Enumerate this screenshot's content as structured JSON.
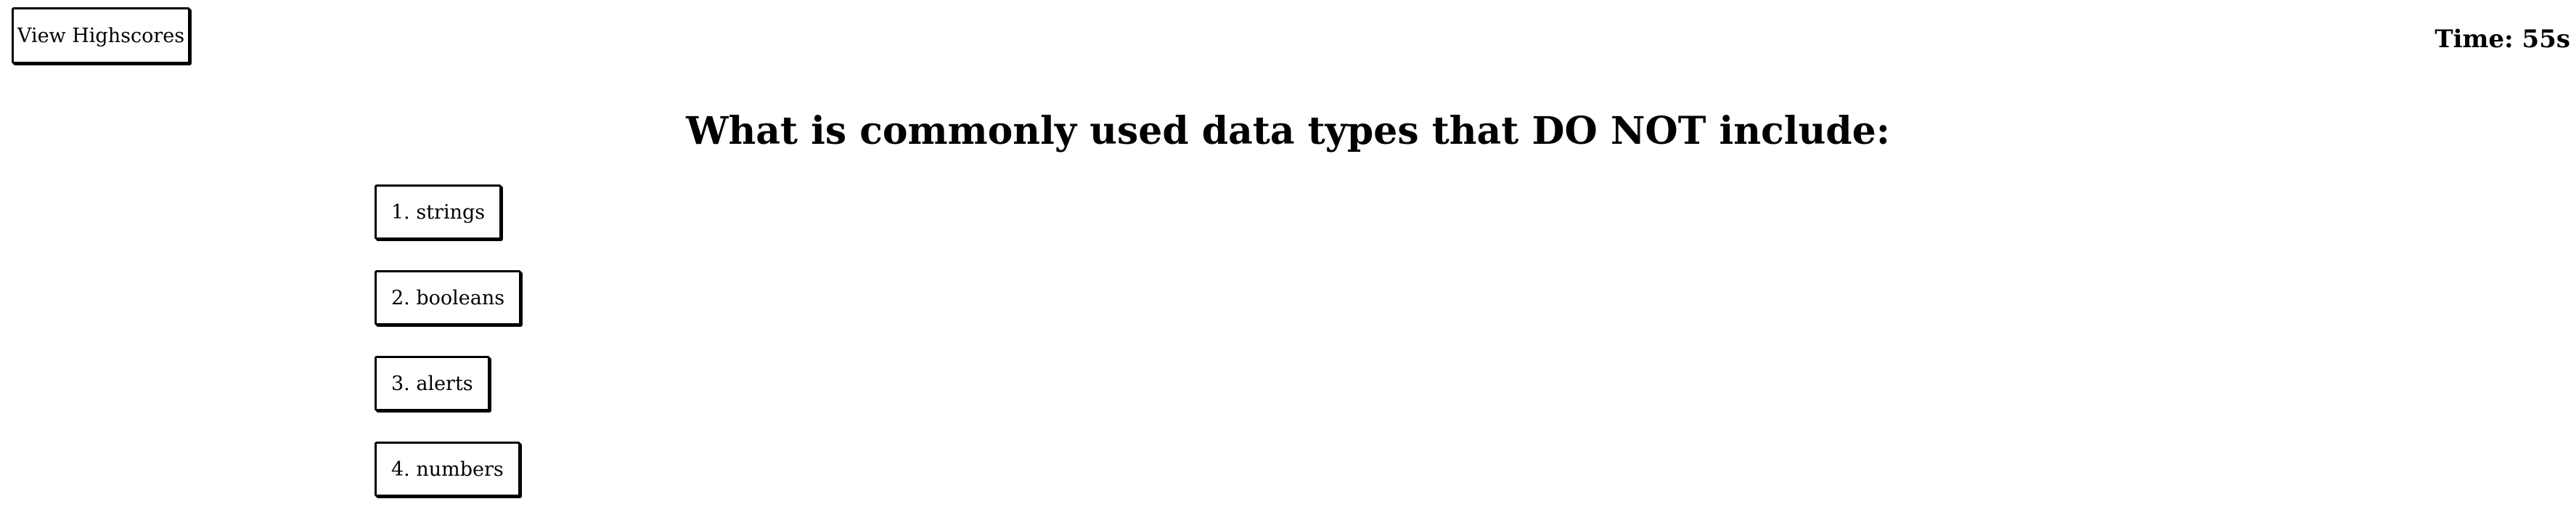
{
  "header": {
    "highscores_label": "View Highscores",
    "timer_text": "Time: 55s"
  },
  "quiz": {
    "question": "What is commonly used data types that DO NOT include:",
    "answers": [
      {
        "label": "1. strings"
      },
      {
        "label": "2. booleans"
      },
      {
        "label": "3. alerts"
      },
      {
        "label": "4. numbers"
      }
    ]
  }
}
